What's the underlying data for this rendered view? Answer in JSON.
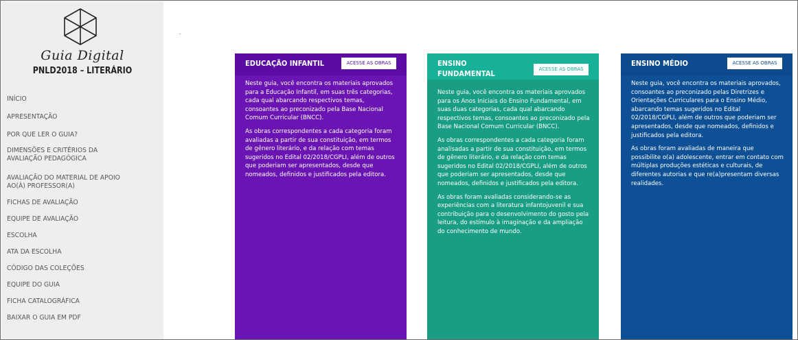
{
  "brand": {
    "script_title": "Guia Digital",
    "subtitle": "PNLD2018 – LITERÁRIO"
  },
  "sidebar": {
    "items": [
      {
        "label": "INÍCIO"
      },
      {
        "label": "APRESENTAÇÃO"
      },
      {
        "label": "POR QUE LER O GUIA?"
      },
      {
        "label": "DIMENSÕES E CRITÉRIOS DA"
      },
      {
        "label": "AVALIAÇÃO PEDAGÓGICA"
      },
      {
        "label": "AVALIAÇÃO DO MATERIAL DE APOIO"
      },
      {
        "label": "AO(À) PROFESSOR(A)"
      },
      {
        "label": "FICHAS DE AVALIAÇÃO"
      },
      {
        "label": "EQUIPE DE AVALIAÇÃO"
      },
      {
        "label": "ESCOLHA"
      },
      {
        "label": "ATA DA ESCOLHA"
      },
      {
        "label": "CÓDIGO DAS COLEÇÕES"
      },
      {
        "label": "EQUIPE DO GUIA"
      },
      {
        "label": "FICHA CATALOGRÁFICA"
      },
      {
        "label": "BAIXAR O GUIA EM PDF"
      }
    ]
  },
  "cards": [
    {
      "title": "EDUCAÇÃO INFANTIL",
      "button": "ACESSE AS OBRAS",
      "paragraphs": [
        "Neste guia, você encontra os materiais aprovados para a Educação Infantil, em suas três categorias, cada qual abarcando respectivos temas, consoantes ao preconizado pela Base Nacional Comum Curricular (BNCC).",
        "As obras correspondentes a cada categoria foram avaliadas a partir de sua constituição, em termos de gênero literário, e da relação com temas sugeridos no Edital 02/2018/CGPLI, além de outros que poderiam ser apresentados, desde que nomeados, definidos e justificados pela editora."
      ]
    },
    {
      "title_line1": "ENSINO",
      "title_line2": "FUNDAMENTAL",
      "button": "ACESSE AS OBRAS",
      "paragraphs": [
        "Neste guia, você encontra os materiais aprovados para os Anos Iniciais do Ensino Fundamental, em suas duas categorias, cada qual abarcando respectivos temas, consoantes ao preconizado pela Base Nacional Comum Curricular (BNCC).",
        "As obras correspondentes a cada categoria foram analisadas a partir de sua constituição, em termos de gênero literário, e da relação com temas sugeridos no Edital 02/2018/CGPLI, além de outros que poderiam ser apresentados, desde que nomeados, definidos e justificados pela editora.",
        "As obras foram avaliadas considerando-se as experiências com a literatura infantojuvenil e sua contribuição para o desenvolvimento do gosto pela leitura, do estímulo à imaginação e da ampliação do conhecimento de mundo."
      ]
    },
    {
      "title": "ENSINO MÉDIO",
      "button": "ACESSE AS OBRAS",
      "paragraphs": [
        "Neste guia, você encontra os materiais aprovados, consoantes ao preconizado pelas Diretrizes e Orientações Curriculares para o Ensino Médio, abarcando temas sugeridos no Edital 02/2018/CGPLI, além de outros que poderiam ser apresentados, desde que nomeados, definidos e justificados pela editora.",
        "As obras foram avaliadas de maneira que possibilite o(a) adolescente, entrar em contato com múltiplas produções estéticas e culturais, de diferentes autorias e que re(a)presentam diversas realidades."
      ]
    }
  ],
  "colors": {
    "infantil": "#6a14b3",
    "fundamental": "#1a9e83",
    "medio": "#0e5096",
    "sidebar_bg": "#eeeeee"
  },
  "icons": {
    "logo": "cube-wireframe-icon"
  }
}
